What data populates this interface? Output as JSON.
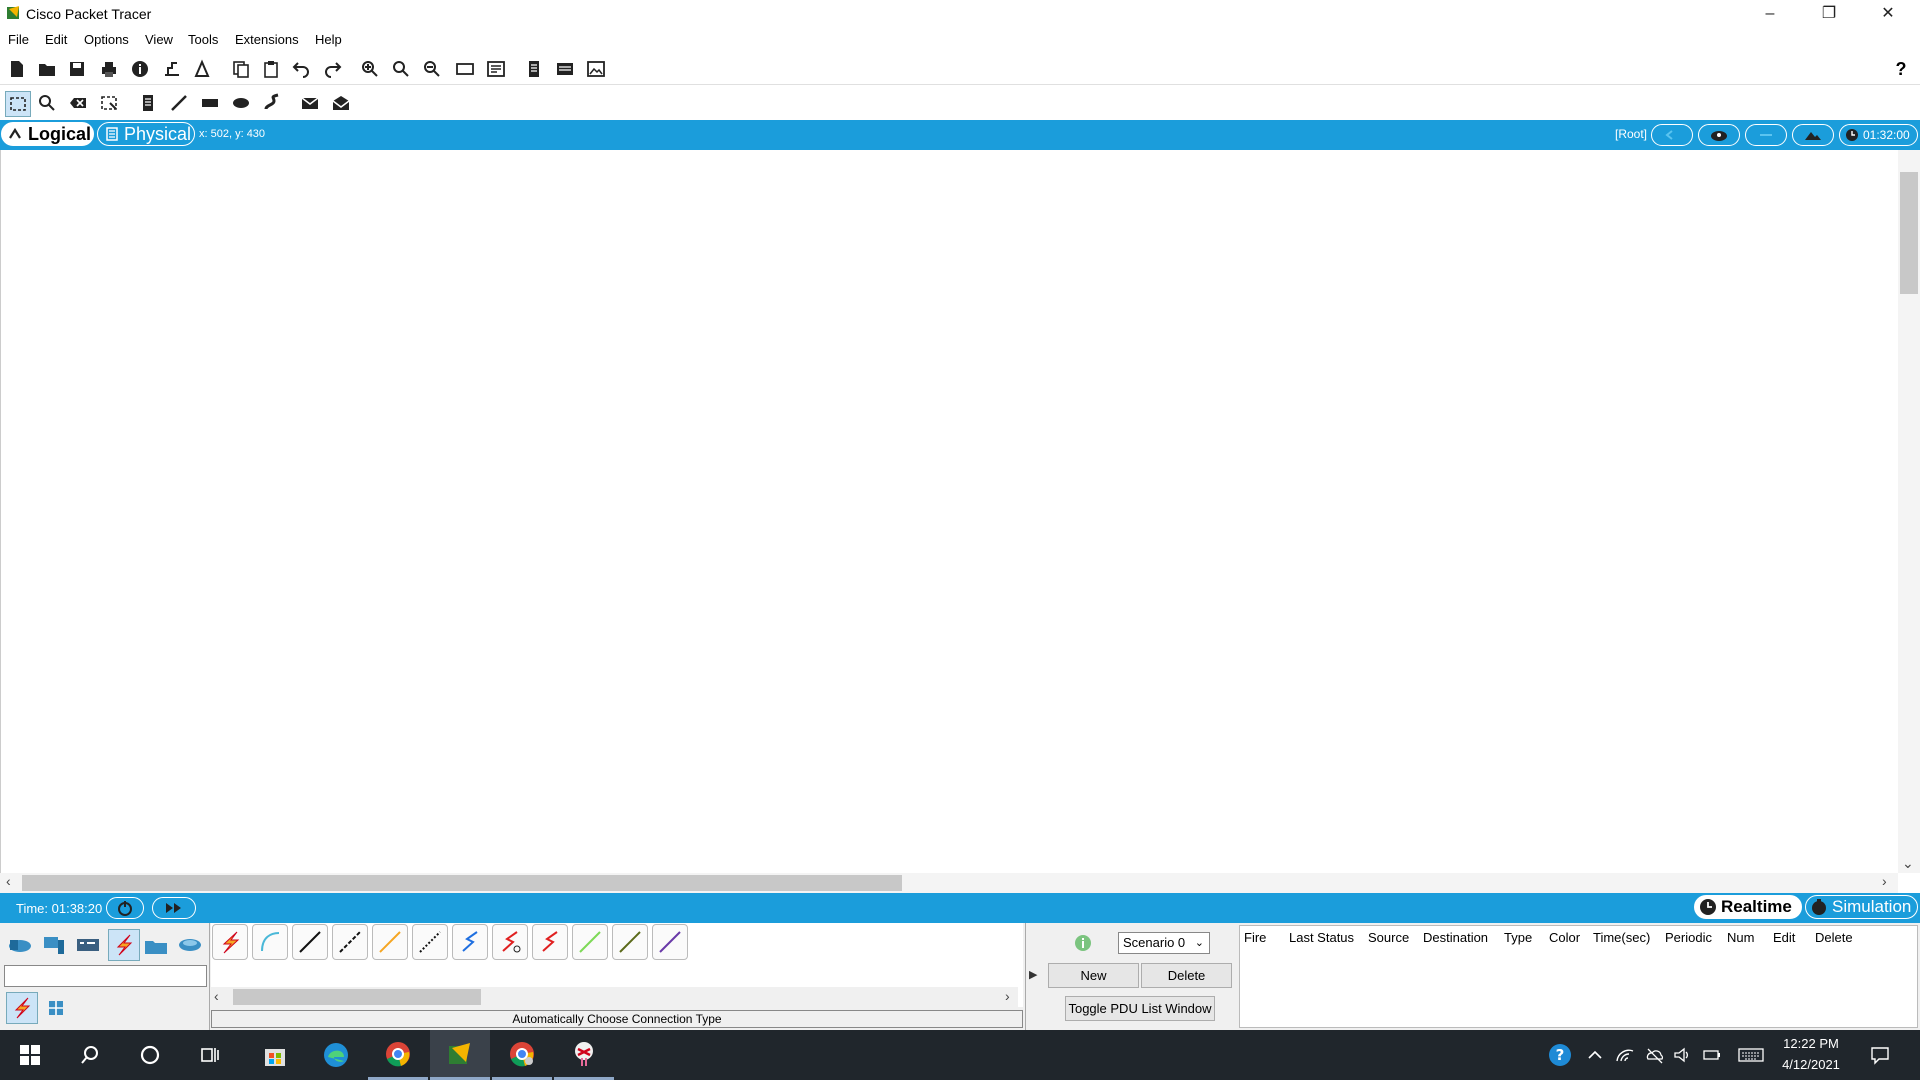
{
  "window": {
    "title": "Cisco Packet Tracer",
    "controls": [
      "–",
      "❐",
      "✕"
    ]
  },
  "menu": [
    "File",
    "Edit",
    "Options",
    "View",
    "Tools",
    "Extensions",
    "Help"
  ],
  "workspace": {
    "logical_label": "Logical",
    "physical_label": "Physical",
    "cursor_coords": "x: 502, y: 430",
    "root_label": "[Root]",
    "clock": "01:32:00"
  },
  "statusbar": {
    "time_label": "Time: 01:38:20",
    "realtime_label": "Realtime",
    "simulation_label": "Simulation"
  },
  "bottom": {
    "connection_type_label": "Automatically Choose Connection Type",
    "scenario_value": "Scenario 0",
    "new_label": "New",
    "delete_label": "Delete",
    "toggle_pdu_label": "Toggle PDU List Window",
    "pdu_columns": [
      "Fire",
      "Last Status",
      "Source",
      "Destination",
      "Type",
      "Color",
      "Time(sec)",
      "Periodic",
      "Num",
      "Edit",
      "Delete"
    ]
  },
  "taskbar": {
    "time": "12:22 PM",
    "date": "4/12/2021"
  },
  "colors": {
    "accent_blue": "#1b9ddb",
    "taskbar": "#20262c"
  }
}
